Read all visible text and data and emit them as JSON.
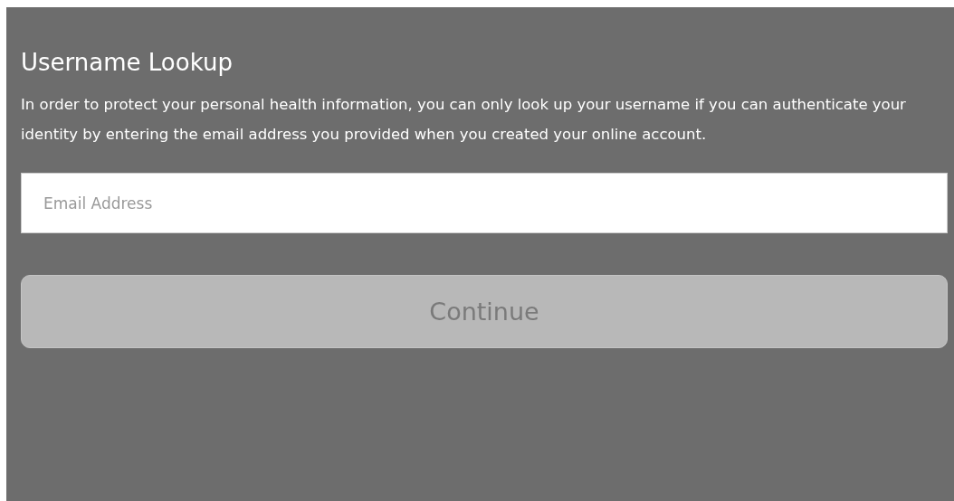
{
  "title": "Username Lookup",
  "description": "In order to protect your personal health information, you can only look up your username if you can authenticate your identity by entering the email address you provided when you created your online account.",
  "email_field": {
    "placeholder": "Email Address"
  },
  "continue_button": {
    "label": "Continue",
    "disabled": true
  }
}
